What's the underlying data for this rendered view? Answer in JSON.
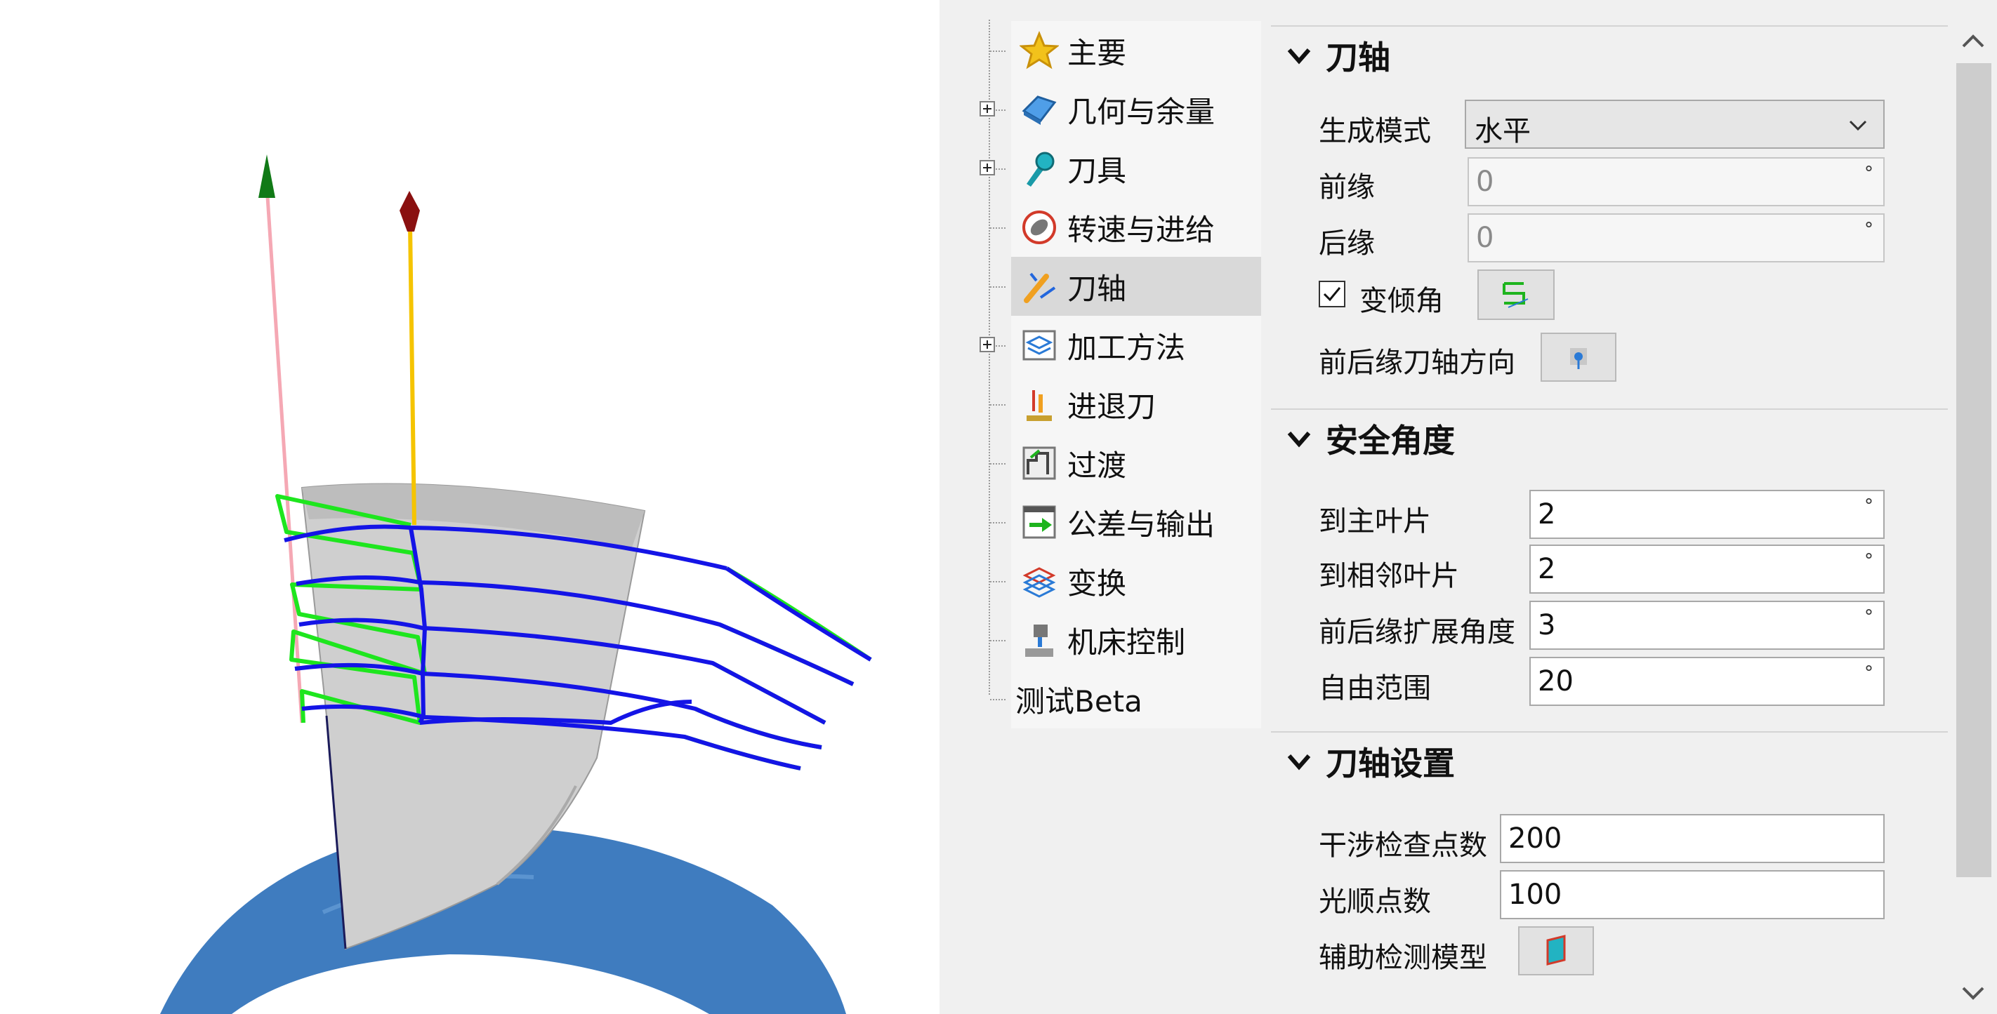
{
  "tree": {
    "items": [
      {
        "label": "主要",
        "icon": "star-icon",
        "expandable": false
      },
      {
        "label": "几何与余量",
        "icon": "geometry-icon",
        "expandable": true
      },
      {
        "label": "刀具",
        "icon": "tool-icon",
        "expandable": true
      },
      {
        "label": "转速与进给",
        "icon": "speed-feed-icon",
        "expandable": false
      },
      {
        "label": "刀轴",
        "icon": "tool-axis-icon",
        "expandable": false,
        "selected": true
      },
      {
        "label": "加工方法",
        "icon": "machining-method-icon",
        "expandable": true
      },
      {
        "label": "进退刀",
        "icon": "lead-in-out-icon",
        "expandable": false
      },
      {
        "label": "过渡",
        "icon": "transition-icon",
        "expandable": false
      },
      {
        "label": "公差与输出",
        "icon": "tolerance-output-icon",
        "expandable": false
      },
      {
        "label": "变换",
        "icon": "transform-icon",
        "expandable": false
      },
      {
        "label": "机床控制",
        "icon": "machine-control-icon",
        "expandable": false
      },
      {
        "label": "测试Beta",
        "icon": "",
        "expandable": false
      }
    ]
  },
  "sections": {
    "tool_axis": {
      "title": "刀轴",
      "generation_mode_label": "生成模式",
      "generation_mode_value": "水平",
      "leading_edge_label": "前缘",
      "leading_edge_value": "0",
      "trailing_edge_label": "后缘",
      "trailing_edge_value": "0",
      "variable_tilt_label": "变倾角",
      "variable_tilt_checked": true,
      "edge_axis_direction_label": "前后缘刀轴方向"
    },
    "safety_angle": {
      "title": "安全角度",
      "to_main_blade_label": "到主叶片",
      "to_main_blade_value": "2",
      "to_adjacent_blade_label": "到相邻叶片",
      "to_adjacent_blade_value": "2",
      "edge_extension_label": "前后缘扩展角度",
      "edge_extension_value": "3",
      "free_range_label": "自由范围",
      "free_range_value": "20"
    },
    "tool_axis_settings": {
      "title": "刀轴设置",
      "interference_points_label": "干涉检查点数",
      "interference_points_value": "200",
      "smoothing_points_label": "光顺点数",
      "smoothing_points_value": "100",
      "aux_model_label": "辅助检测模型"
    }
  },
  "units": {
    "degree": "°"
  },
  "colors": {
    "toolpath": "#1414e6",
    "link_moves": "#1ee61e",
    "hub": "#3f7cbf",
    "blade": "#cfcfcf",
    "axis_green": "#117a17",
    "axis_red": "#8a1010",
    "axis_yellow": "#f5c400",
    "axis_pink": "#f5a8b4"
  }
}
